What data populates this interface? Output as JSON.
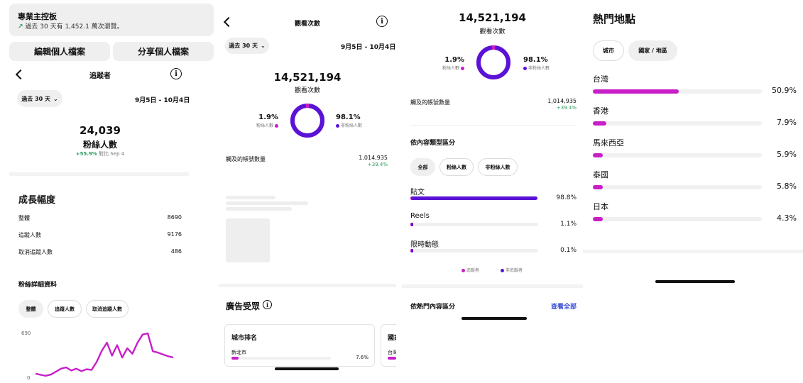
{
  "colors": {
    "magenta": "#c81ec8",
    "purple": "#5a13d6",
    "green": "#2a9d5b"
  },
  "p1": {
    "dashboard": {
      "title": "專業主控板",
      "subtitle": "過去 30 天有 1,452.1 萬次瀏覽。",
      "trend_icon": "arrow-up-right-icon"
    },
    "edit_profile": "編輯個人檔案",
    "share_profile": "分享個人檔案",
    "header_title": "追蹤者",
    "period": "過去 30 天",
    "date_range": "9月5日 - 10月4日",
    "followers_count": "24,039",
    "followers_label": "粉絲人數",
    "followers_change": "+55.9%",
    "followers_compare": "對比 Sep 4",
    "growth_title": "成長幅度",
    "growth_rows": [
      {
        "label": "整體",
        "value": "8690"
      },
      {
        "label": "追蹤人數",
        "value": "9176"
      },
      {
        "label": "取消追蹤人數",
        "value": "486"
      }
    ],
    "details_title": "粉絲詳細資料",
    "detail_chips": [
      "整體",
      "追蹤人數",
      "取消追蹤人數"
    ]
  },
  "chart_data": {
    "type": "line",
    "title": "",
    "xlabel": "",
    "ylabel": "",
    "y_ticks": [
      "690",
      "0"
    ],
    "ylim": [
      0,
      690
    ],
    "grid": false,
    "series": [
      {
        "values": [
          60,
          40,
          25,
          45,
          90,
          140,
          160,
          110,
          140,
          100,
          130,
          120,
          250,
          430,
          560,
          350,
          520,
          320,
          470,
          380,
          560,
          690,
          710,
          420,
          400,
          370,
          340,
          320
        ]
      }
    ]
  },
  "p2": {
    "header_title": "觀看次數",
    "period": "過去 30 天",
    "date_range": "9月5日 - 10月4日",
    "views_count": "14,521,194",
    "views_label": "觀看次數",
    "followers_pct": "1.9%",
    "followers_label": "粉絲人數",
    "non_followers_pct": "98.1%",
    "non_followers_label": "非粉絲人數",
    "donut_fraction": 0.981,
    "accounts_label": "觸及的帳號數量",
    "accounts_value": "1,014,935",
    "accounts_change": "+39.4%",
    "audience_title": "廣告受眾",
    "card1_title": "城市排名",
    "card1_row_label": "新北市",
    "card1_row_value": "7.6%",
    "card2_title": "國家",
    "card2_row_label": "台灣"
  },
  "p3": {
    "views_count": "14,521,194",
    "views_label": "觀看次數",
    "followers_pct": "1.9%",
    "followers_label": "粉絲人數",
    "non_followers_pct": "98.1%",
    "non_followers_label": "非粉絲人數",
    "donut_fraction": 0.981,
    "accounts_label": "觸及的帳號數量",
    "accounts_value": "1,014,935",
    "accounts_change": "+39.4%",
    "content_title": "依內容類型區分",
    "content_chips": [
      "全部",
      "粉絲人數",
      "非粉絲人數"
    ],
    "content_rows": [
      {
        "label": "貼文",
        "value": "98.8%",
        "fraction": 0.988
      },
      {
        "label": "Reels",
        "value": "1.1%",
        "fraction": 0.011
      },
      {
        "label": "限時動態",
        "value": "0.1%",
        "fraction": 0.001
      }
    ],
    "legend_followers": "追蹤者",
    "legend_non_followers": "非追蹤者",
    "top_content_title": "依熱門內容區分",
    "see_all": "查看全部"
  },
  "p4": {
    "title": "熱門地點",
    "chips": [
      "城市",
      "國家 / 地區"
    ],
    "locations": [
      {
        "label": "台灣",
        "value": "50.9%",
        "fraction": 0.509
      },
      {
        "label": "香港",
        "value": "7.9%",
        "fraction": 0.079
      },
      {
        "label": "馬來西亞",
        "value": "5.9%",
        "fraction": 0.059
      },
      {
        "label": "泰國",
        "value": "5.8%",
        "fraction": 0.058
      },
      {
        "label": "日本",
        "value": "4.3%",
        "fraction": 0.043
      }
    ]
  }
}
